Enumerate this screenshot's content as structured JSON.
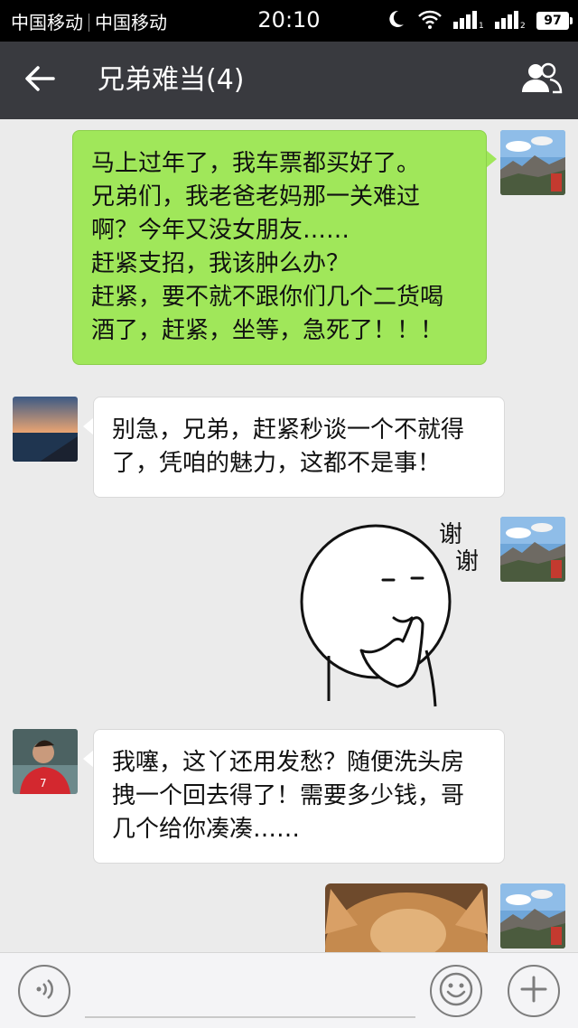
{
  "status_bar": {
    "carrier_1": "中国移动",
    "carrier_2": "中国移动",
    "time": "20:10",
    "battery": "97"
  },
  "header": {
    "title": "兄弟难当(4)",
    "back_icon": "arrow-left-icon",
    "members_icon": "group-members-icon"
  },
  "messages": [
    {
      "sender": "self",
      "type": "text",
      "lines": [
        "马上过年了，我车票都买好了。",
        "兄弟们，我老爸老妈那一关难过",
        "啊？今年又没女朋友……",
        "赶紧支招，我该肿么办？",
        "赶紧，要不就不跟你们几个二货喝",
        "酒了，赶紧，坐等，急死了！！！"
      ]
    },
    {
      "sender": "friend_sunset",
      "type": "text",
      "lines": [
        "别急，兄弟，赶紧秒谈一个不就得",
        "了，凭咱的魅力，这都不是事！"
      ]
    },
    {
      "sender": "self",
      "type": "sticker",
      "sticker_text": [
        "谢",
        "谢"
      ]
    },
    {
      "sender": "friend_footballer",
      "type": "text",
      "lines": [
        "我噻，这丫还用发愁？随便洗头房",
        "拽一个回去得了！需要多少钱，哥",
        "几个给你凑凑……"
      ]
    },
    {
      "sender": "self",
      "type": "image",
      "image_subject": "dog-photo"
    }
  ],
  "input_bar": {
    "placeholder": "",
    "voice_icon": "voice-icon",
    "emoji_icon": "emoji-icon",
    "plus_icon": "plus-icon"
  },
  "colors": {
    "nav_bg": "#393a3f",
    "chat_bg": "#ebebeb",
    "self_bubble": "#a0e75a",
    "friend_bubble": "#ffffff"
  }
}
